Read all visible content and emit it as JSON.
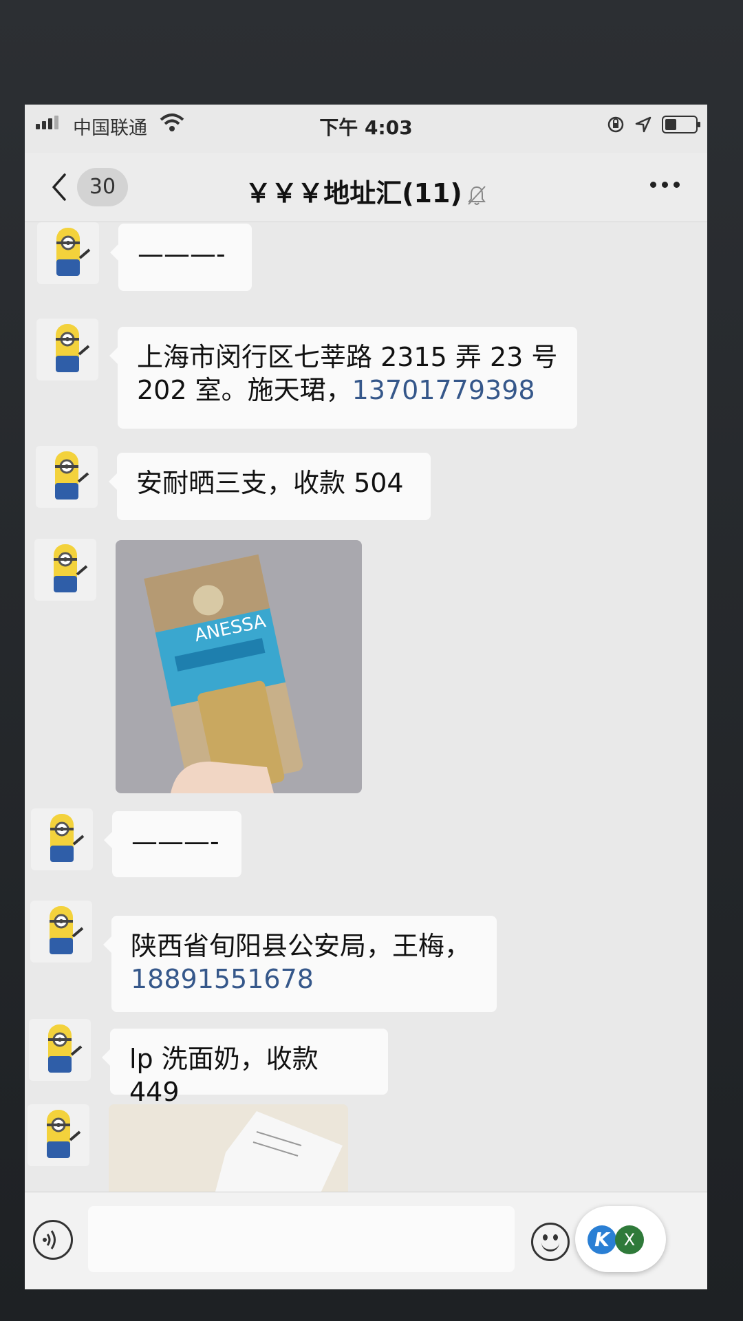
{
  "status_bar": {
    "carrier": "中国联通",
    "time": "下午 4:03"
  },
  "nav": {
    "unread_count": "30",
    "title": "￥￥￥地址汇(11)"
  },
  "messages": [
    {
      "type": "text",
      "text": "———-"
    },
    {
      "type": "text",
      "text": "上海市闵行区七莘路 2315 弄 23 号 202 室。施天珺，",
      "phone": "13701779398"
    },
    {
      "type": "text",
      "text": "安耐晒三支，收款 504"
    },
    {
      "type": "image",
      "image_label": "ANESSA"
    },
    {
      "type": "text",
      "text": "———-"
    },
    {
      "type": "text",
      "text": "陕西省旬阳县公安局，王梅，",
      "phone": "18891551678"
    },
    {
      "type": "text",
      "text": "lp 洗面奶，收款 449"
    },
    {
      "type": "image"
    }
  ],
  "floating_widget": {
    "k_label": "K",
    "x_label": "X"
  },
  "icons": [
    "back-chevron-icon",
    "mute-bell-icon",
    "more-icon",
    "voice-icon",
    "emoji-icon",
    "avatar-minion-icon"
  ]
}
